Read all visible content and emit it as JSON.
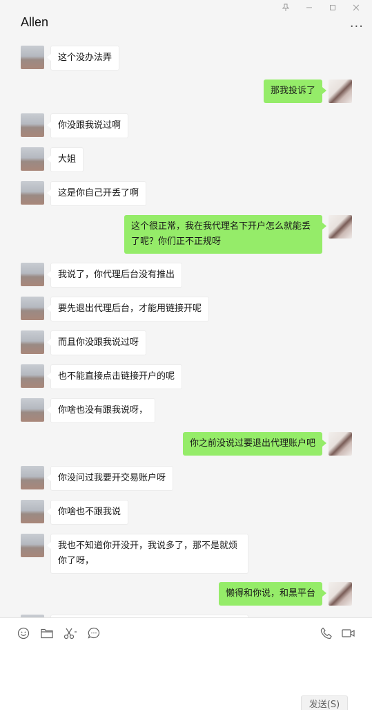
{
  "window": {
    "controls": [
      "📌",
      "—",
      "☐",
      "✕"
    ]
  },
  "header": {
    "title": "Allen",
    "more": "..."
  },
  "messages": [
    {
      "side": "left",
      "text": "这个没办法弄"
    },
    {
      "side": "right",
      "text": "那我投诉了"
    },
    {
      "side": "left",
      "text": "你没跟我说过啊"
    },
    {
      "side": "left",
      "text": "大姐"
    },
    {
      "side": "left",
      "text": "这是你自己开丢了啊"
    },
    {
      "side": "right",
      "text": "这个很正常，我在我代理名下开户怎么就能丢了呢？你们正不正规呀"
    },
    {
      "side": "left",
      "text": "我说了，你代理后台没有推出"
    },
    {
      "side": "left",
      "text": "要先退出代理后台，才能用链接开呢"
    },
    {
      "side": "left",
      "text": "而且你没跟我说过呀"
    },
    {
      "side": "left",
      "text": "也不能直接点击链接开户的呢"
    },
    {
      "side": "left",
      "text": "你啥也没有跟我说呀，"
    },
    {
      "side": "right",
      "text": "你之前没说过要退出代理账户吧"
    },
    {
      "side": "left",
      "text": "你没问过我要开交易账户呀"
    },
    {
      "side": "left",
      "text": "你啥也不跟我说"
    },
    {
      "side": "left",
      "text": "我也不知道你开没开，我说多了，那不是就烦你了呀，"
    },
    {
      "side": "right",
      "text": "懒得和你说，和黑平台"
    }
  ],
  "toolbar": {
    "icons": [
      "emoji-icon",
      "folder-icon",
      "scissors-icon",
      "chat-bubble-icon"
    ],
    "right_icons": [
      "phone-icon",
      "video-icon"
    ]
  },
  "send_button": {
    "label": "发送(S)"
  },
  "colors": {
    "self_bubble": "#95ec69",
    "other_bubble": "#ffffff",
    "background": "#f5f5f5"
  }
}
